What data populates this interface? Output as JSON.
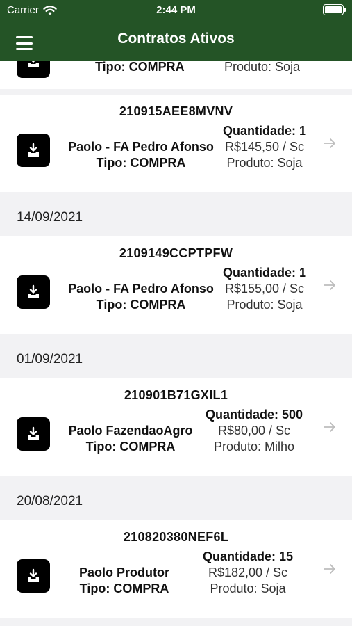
{
  "status_bar": {
    "carrier": "Carrier",
    "time": "2:44 PM"
  },
  "header": {
    "title": "Contratos Ativos"
  },
  "partial_top": {
    "tipo": "Tipo: COMPRA",
    "produto": "Produto: Soja"
  },
  "groups": [
    {
      "contracts": [
        {
          "code": "210915AEE8MVNV",
          "name": "Paolo - FA Pedro Afonso",
          "tipo": "Tipo: COMPRA",
          "quantidade": "Quantidade: 1",
          "preco": "R$145,50 / Sc",
          "produto": "Produto: Soja"
        }
      ]
    },
    {
      "date": "14/09/2021",
      "contracts": [
        {
          "code": "2109149CCPTPFW",
          "name": "Paolo - FA Pedro Afonso",
          "tipo": "Tipo: COMPRA",
          "quantidade": "Quantidade: 1",
          "preco": "R$155,00 / Sc",
          "produto": "Produto: Soja"
        }
      ]
    },
    {
      "date": "01/09/2021",
      "contracts": [
        {
          "code": "210901B71GXIL1",
          "name": "Paolo FazendaoAgro",
          "tipo": "Tipo: COMPRA",
          "quantidade": "Quantidade: 500",
          "preco": "R$80,00 / Sc",
          "produto": "Produto: Milho"
        }
      ]
    },
    {
      "date": "20/08/2021",
      "contracts": [
        {
          "code": "210820380NEF6L",
          "name": "Paolo Produtor",
          "tipo": "Tipo: COMPRA",
          "quantidade": "Quantidade: 15",
          "preco": "R$182,00 / Sc",
          "produto": "Produto: Soja"
        }
      ]
    }
  ],
  "colors": {
    "header_bg": "#245426",
    "page_bg": "#f2f2f4",
    "card_bg": "#ffffff",
    "icon_bg": "#000000",
    "arrow": "#bdbdbd"
  },
  "icons": {
    "menu": "hamburger-icon",
    "download": "download-tray-icon",
    "arrow": "arrow-right-icon",
    "wifi": "wifi-icon",
    "battery": "battery-icon"
  }
}
